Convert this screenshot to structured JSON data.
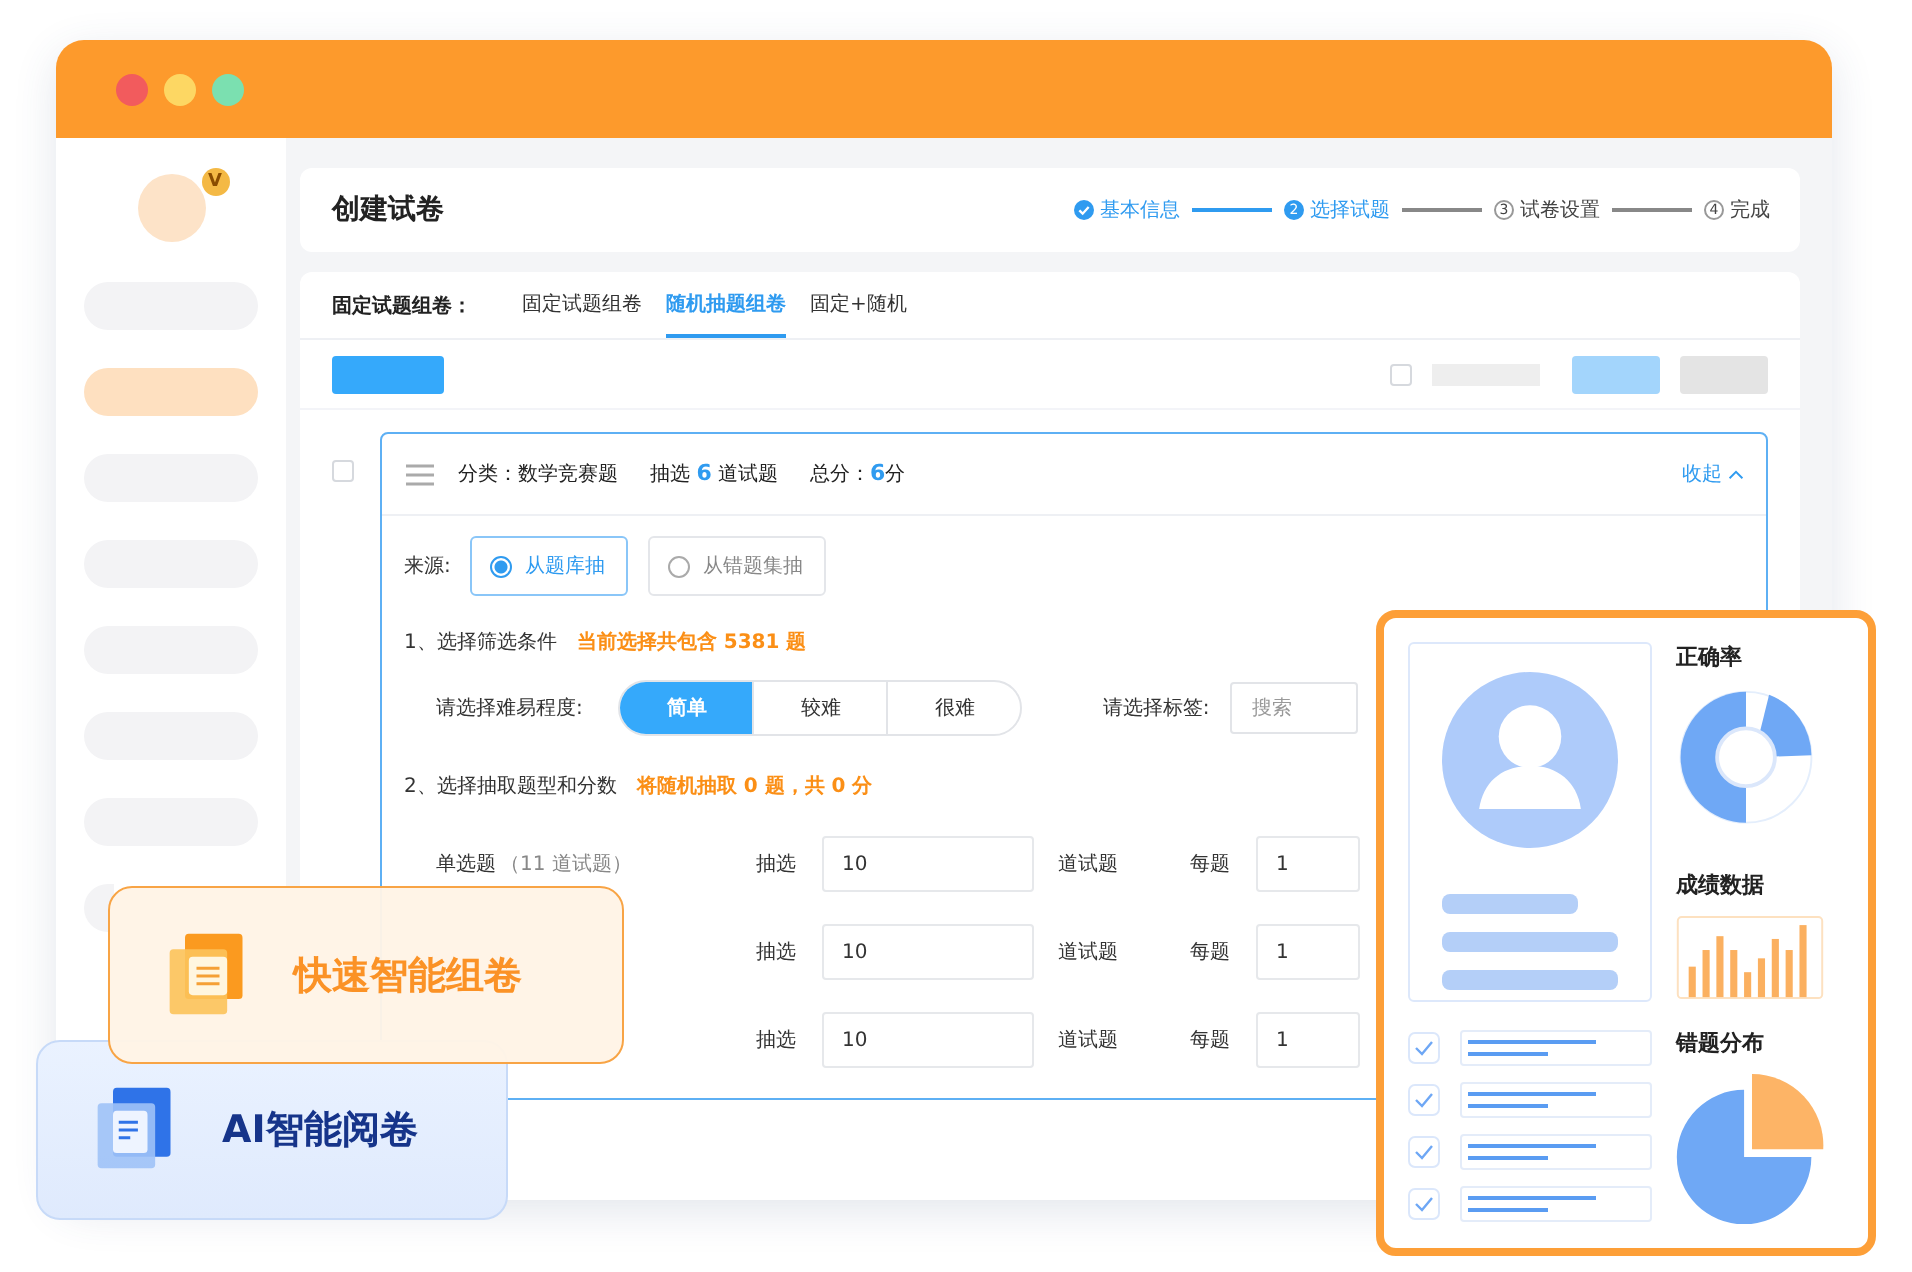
{
  "window": {
    "avatar_badge": "V"
  },
  "sidebar": {
    "items": [
      {
        "selected": false
      },
      {
        "selected": true
      },
      {
        "selected": false
      },
      {
        "selected": false
      },
      {
        "selected": false
      },
      {
        "selected": false
      },
      {
        "selected": false
      },
      {
        "selected": false
      }
    ]
  },
  "header": {
    "title": "创建试卷",
    "steps": [
      {
        "label": "基本信息",
        "done": true,
        "active": false
      },
      {
        "marker": "2",
        "label": "选择试题",
        "done": false,
        "active": true
      },
      {
        "marker": "3",
        "label": "试卷设置",
        "done": false,
        "active": false
      },
      {
        "marker": "4",
        "label": "完成",
        "done": false,
        "active": false
      }
    ]
  },
  "mode_tabs": {
    "label": "固定试题组卷：",
    "tabs": [
      {
        "label": "固定试题组卷",
        "selected": false
      },
      {
        "label": "随机抽题组卷",
        "selected": true
      },
      {
        "label": "固定+随机",
        "selected": false
      }
    ]
  },
  "toolbar": {
    "select_all_checked": false
  },
  "category_card": {
    "checked": false,
    "category": "分类：数学竞赛题",
    "pick_prefix": "抽选",
    "pick_count": "6",
    "pick_suffix": "道试题",
    "score_prefix": "总分：",
    "score_value": "6",
    "score_suffix": "分",
    "collapse": "收起",
    "source_label": "来源:",
    "sources": [
      {
        "label": "从题库抽",
        "selected": true
      },
      {
        "label": "从错题集抽",
        "selected": false
      }
    ],
    "step1_title": "1、选择筛选条件",
    "step1_note": "当前选择共包含 5381 题",
    "difficulty_label": "请选择难易程度:",
    "difficulties": [
      {
        "label": "简单",
        "selected": true
      },
      {
        "label": "较难",
        "selected": false
      },
      {
        "label": "很难",
        "selected": false
      }
    ],
    "tag_label": "请选择标签:",
    "tag_placeholder": "搜索",
    "step2_title": "2、选择抽取题型和分数",
    "step2_note": "将随机抽取 0 题，共 0 分",
    "rows": [
      {
        "type": "单选题",
        "count": "（11 道试题）",
        "pick_label": "抽选",
        "pick_value": "10",
        "pick_unit": "道试题",
        "per_label": "每题",
        "per_value": "1"
      },
      {
        "pick_label": "抽选",
        "pick_value": "10",
        "pick_unit": "道试题",
        "per_label": "每题",
        "per_value": "1"
      },
      {
        "pick_label": "抽选",
        "pick_value": "10",
        "pick_unit": "道试题",
        "per_label": "每题",
        "per_value": "1"
      }
    ]
  },
  "feature_cards": [
    {
      "kind": "compose",
      "title": "快速智能组卷"
    },
    {
      "kind": "grading",
      "title": "AI智能阅卷"
    }
  ],
  "report_panel": {
    "accuracy_title": "正确率",
    "scores_title": "成绩数据",
    "mistakes_title": "错题分布",
    "checklist": [
      {
        "checked": true
      },
      {
        "checked": true
      },
      {
        "checked": true
      },
      {
        "checked": true
      }
    ]
  }
}
